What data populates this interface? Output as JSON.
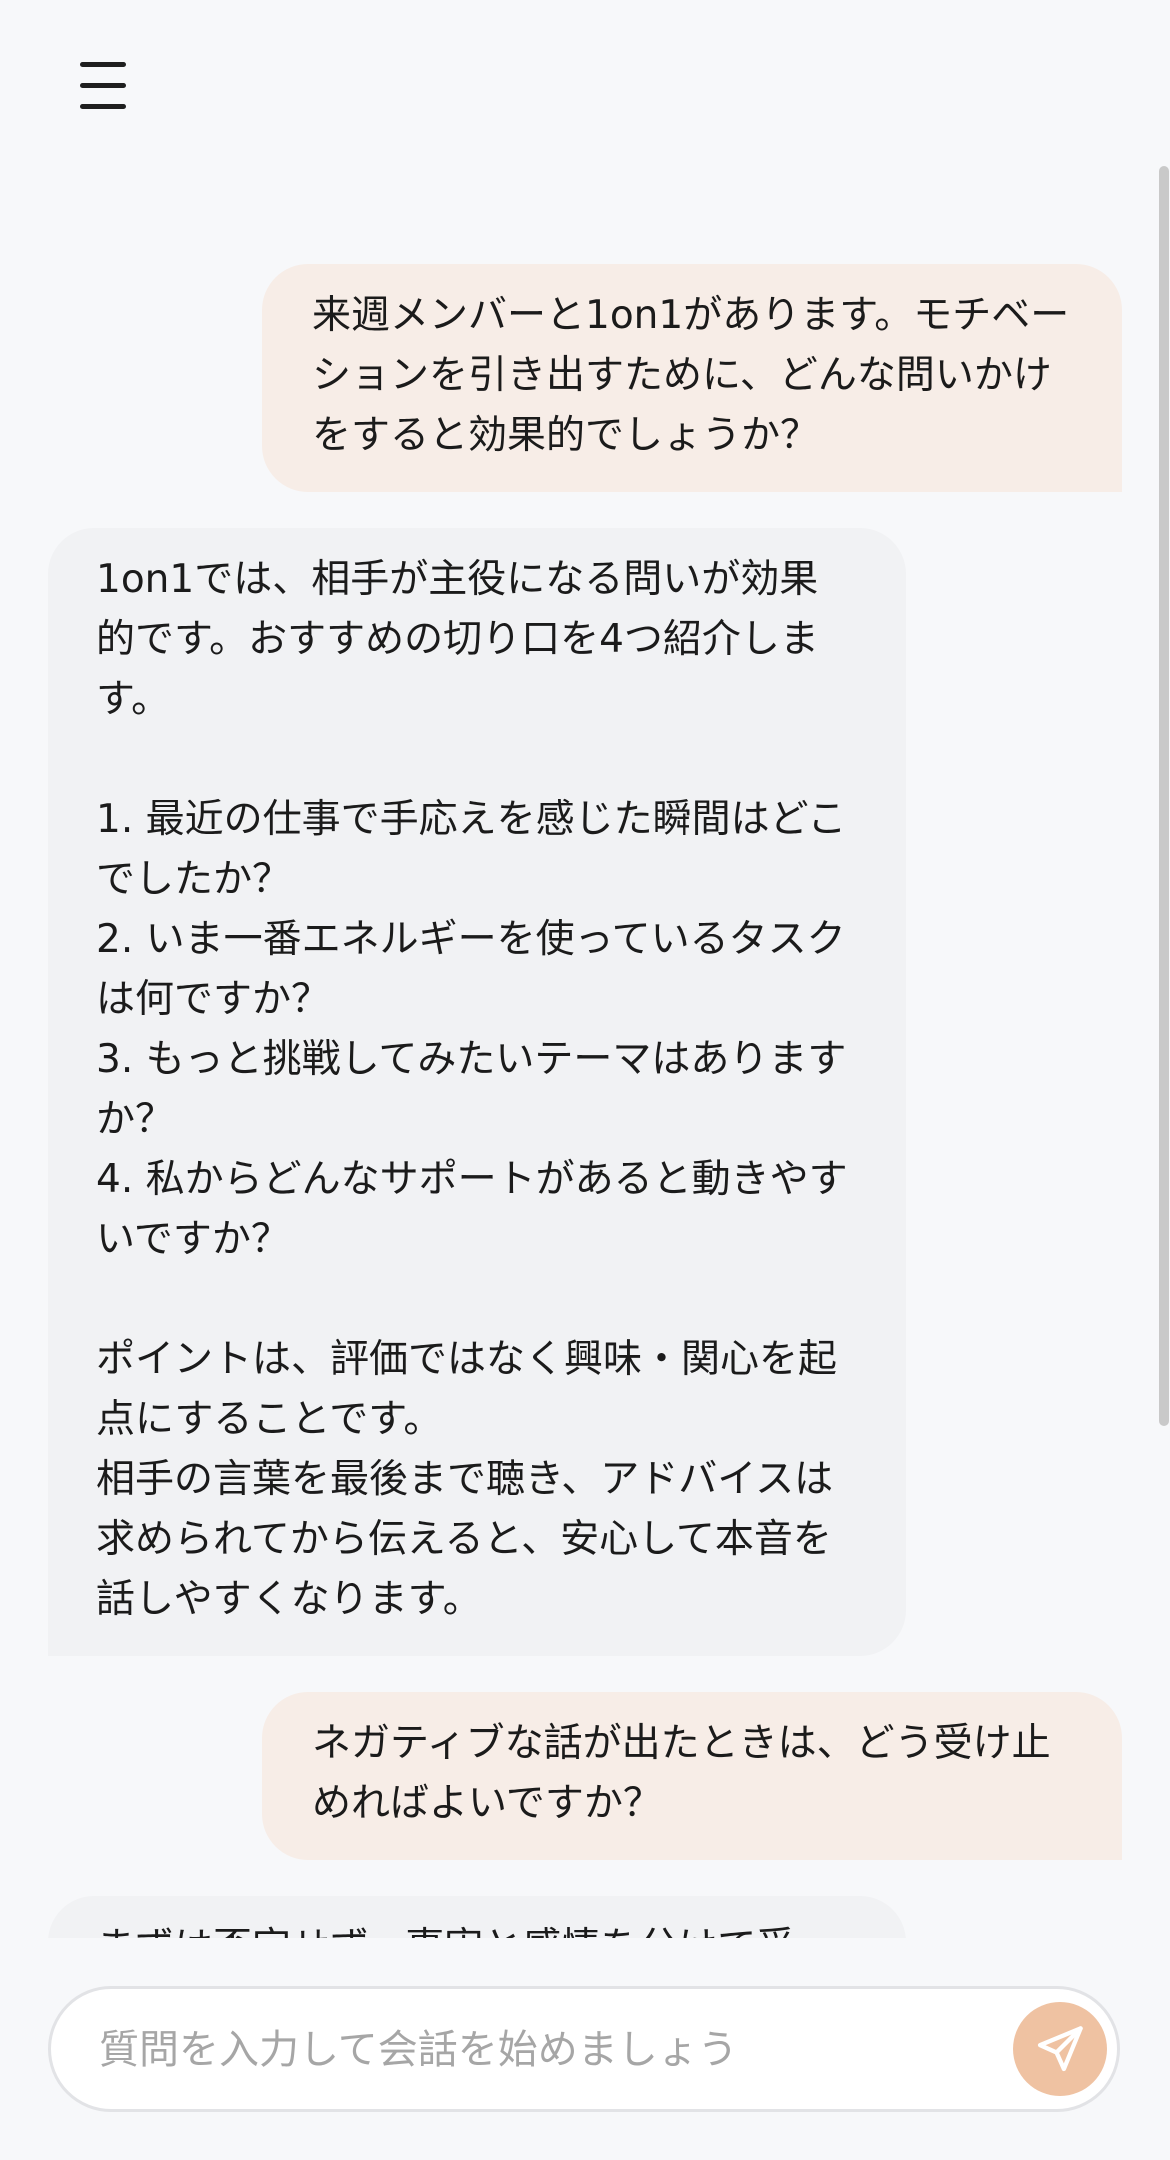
{
  "header": {
    "menu_icon": "hamburger-menu-icon"
  },
  "messages": [
    {
      "role": "user",
      "text": "来週メンバーと1on1があります。モチベーションを引き出すために、どんな問いかけをすると効果的でしょうか？"
    },
    {
      "role": "assistant",
      "text": "1on1では、相手が主役になる問いが効果的です。おすすめの切り口を4つ紹介します。\n\n1. 最近の仕事で手応えを感じた瞬間はどこでしたか？\n2. いま一番エネルギーを使っているタスクは何ですか？\n3. もっと挑戦してみたいテーマはありますか？\n4. 私からどんなサポートがあると動きやすいですか？\n\nポイントは、評価ではなく興味・関心を起点にすることです。\n相手の言葉を最後まで聴き、アドバイスは求められてから伝えると、安心して本音を話しやすくなります。"
    },
    {
      "role": "user",
      "text": "ネガティブな話が出たときは、どう受け止めればよいですか？"
    },
    {
      "role": "assistant",
      "text": "まずは否定せず、事実と感情を分けて受"
    }
  ],
  "composer": {
    "placeholder": "質問を入力して会話を始めましょう",
    "value": "",
    "send_icon": "paper-plane-icon"
  },
  "colors": {
    "background": "#f7f8fa",
    "user_bubble": "#f7ede7",
    "assistant_bubble": "#f1f2f4",
    "send_button": "#efc2a2"
  }
}
